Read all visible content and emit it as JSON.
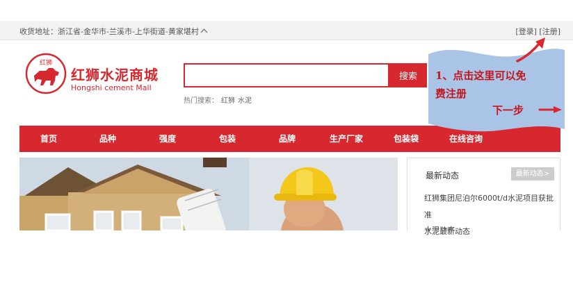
{
  "topbar": {
    "address_label": "收货地址：",
    "address_value": "浙江省-金华市-兰溪市-上华街道-黄家堪村",
    "login": "[登录]",
    "register": "[注册]"
  },
  "brand": {
    "logo_text": "红狮",
    "name_cn": "红狮水泥商城",
    "name_en": "Hongshi cement Mall"
  },
  "search": {
    "placeholder": "",
    "button": "搜索",
    "hot_label": "热门搜索：",
    "hot_keywords": [
      "红狮",
      "水泥"
    ]
  },
  "nav": {
    "items": [
      "首页",
      "品种",
      "强度",
      "包装",
      "品牌",
      "生产厂家",
      "包装袋",
      "在线咨询"
    ]
  },
  "news": {
    "title": "最新动态",
    "more": "最新动态>",
    "items": [
      "红狮集团尼泊尔6000t/d水泥项目获批准",
      "水泥最新动态",
      "水泥动态"
    ]
  },
  "annotation": {
    "line1": "1、点击这里可以免",
    "line2": "费注册",
    "next": "下一步",
    "flag_color": "#a9c4e6",
    "arrow_color": "#d8282f"
  },
  "colors": {
    "brand_red": "#d8282f",
    "topbar_bg": "#f2f2f2"
  }
}
